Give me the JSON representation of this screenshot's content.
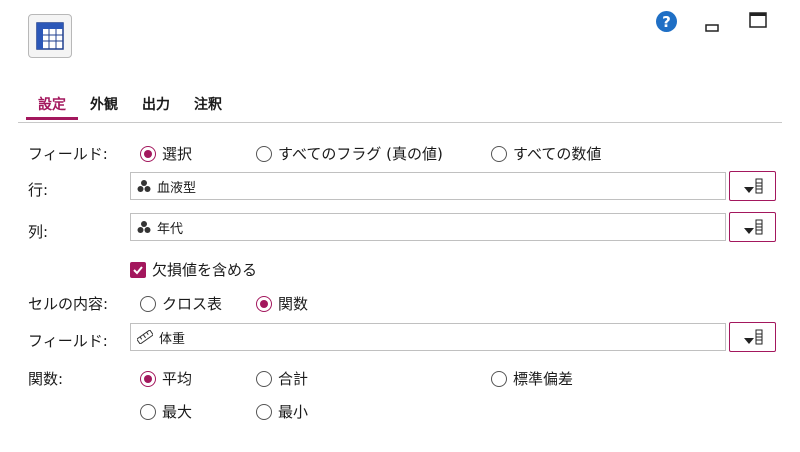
{
  "tabs": [
    "設定",
    "外観",
    "出力",
    "注釈"
  ],
  "colors": {
    "accent": "#a3175d",
    "help": "#1f6fc5"
  },
  "icons": {
    "node": "crosstab-table-icon",
    "help": "help-icon",
    "minimize": "minimize-icon",
    "maximize": "maximize-icon",
    "categorical": "categorical-field-icon",
    "continuous": "continuous-field-icon",
    "picker": "field-picker-icon"
  },
  "fields_row": {
    "label": "フィールド:",
    "options": [
      {
        "label": "選択",
        "selected": true
      },
      {
        "label": "すべてのフラグ (真の値)",
        "selected": false
      },
      {
        "label": "すべての数値",
        "selected": false
      }
    ]
  },
  "row_field": {
    "label": "行:",
    "value": "血液型"
  },
  "col_field": {
    "label": "列:",
    "value": "年代"
  },
  "include_missing": {
    "label": "欠損値を含める",
    "checked": true
  },
  "cell_contents": {
    "label": "セルの内容:",
    "options": [
      {
        "label": "クロス表",
        "selected": false
      },
      {
        "label": "関数",
        "selected": true
      }
    ]
  },
  "function_field": {
    "label": "フィールド:",
    "value": "体重"
  },
  "function": {
    "label": "関数:",
    "options": [
      {
        "label": "平均",
        "selected": true
      },
      {
        "label": "合計",
        "selected": false
      },
      {
        "label": "標準偏差",
        "selected": false
      },
      {
        "label": "最大",
        "selected": false
      },
      {
        "label": "最小",
        "selected": false
      }
    ]
  }
}
